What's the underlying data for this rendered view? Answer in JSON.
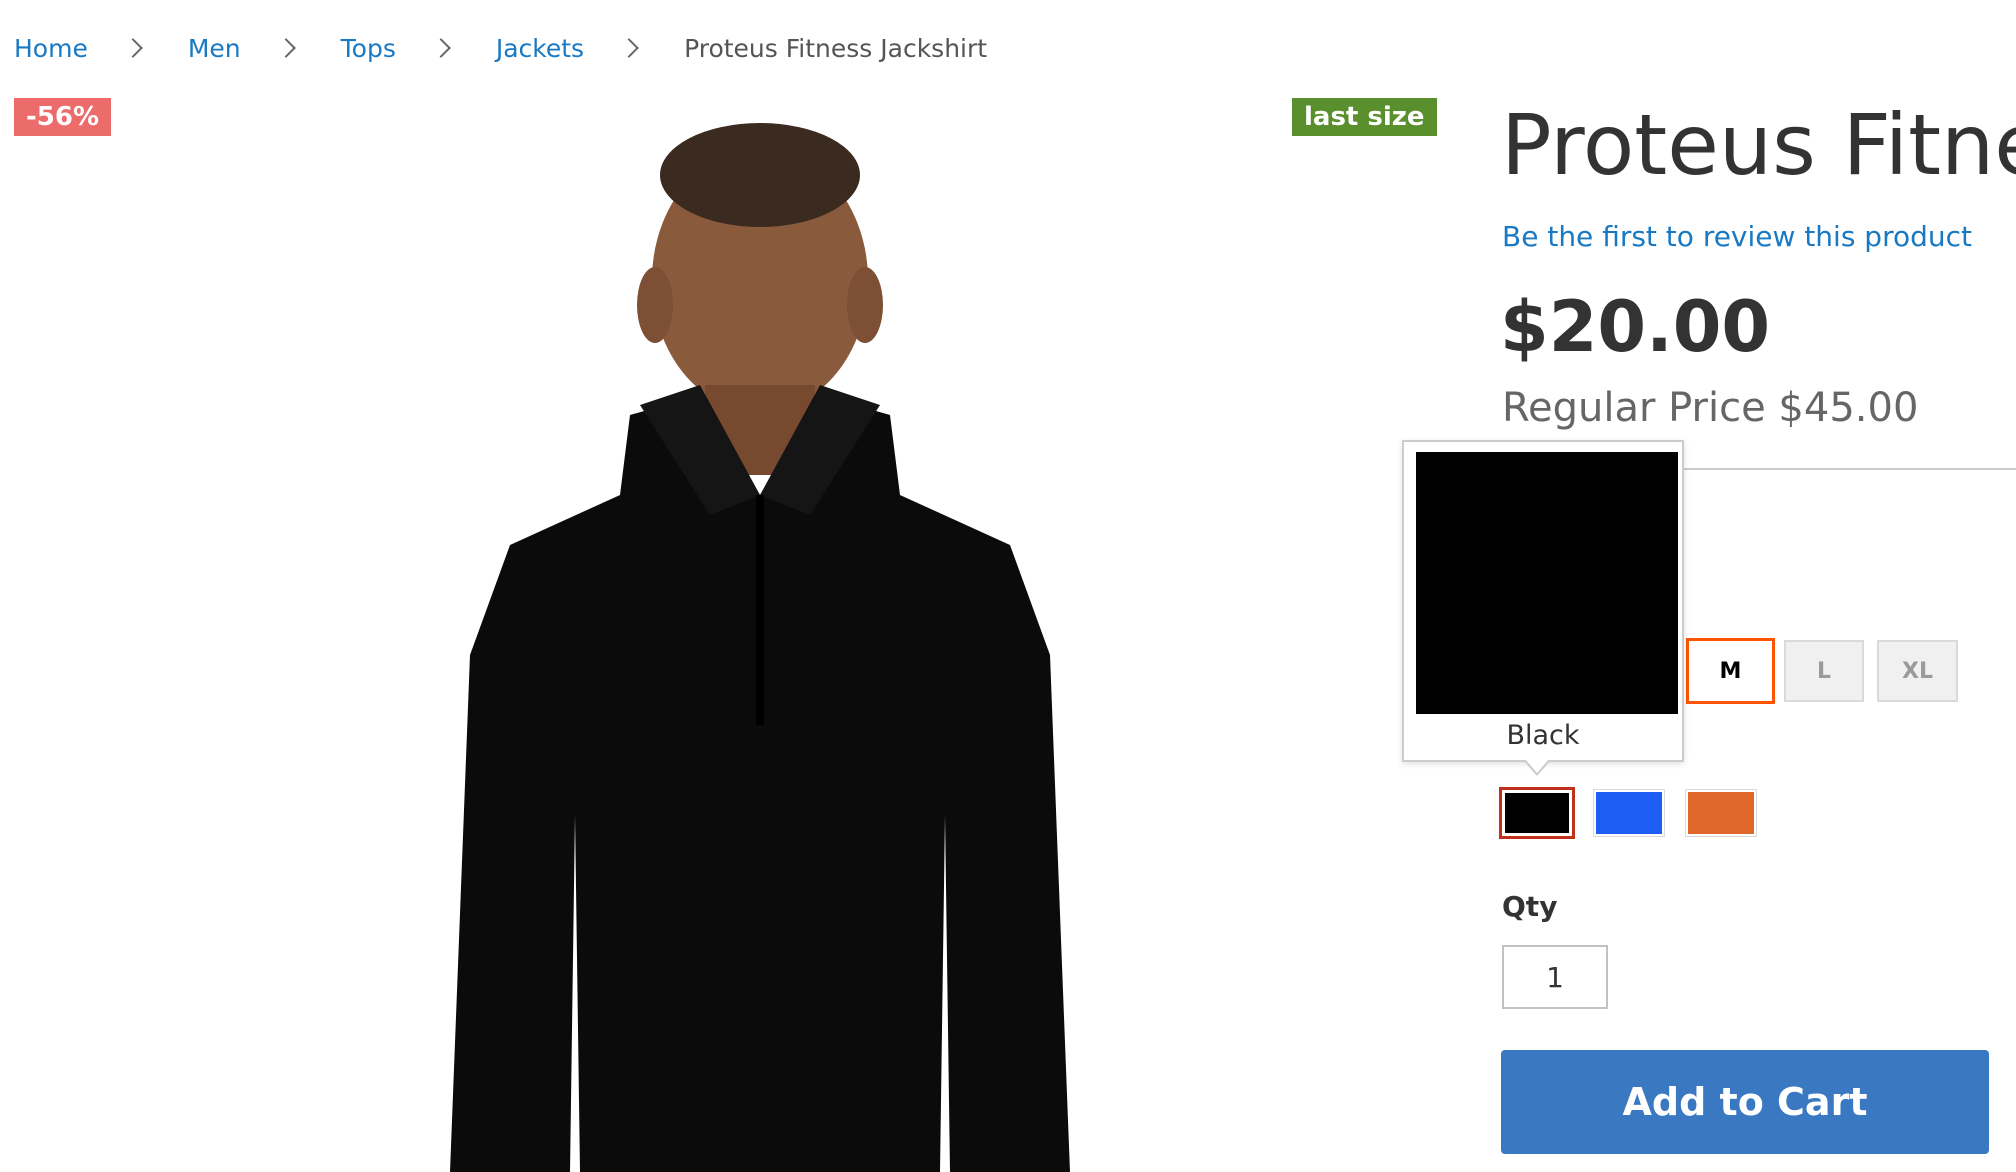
{
  "breadcrumbs": {
    "items": [
      {
        "label": "Home"
      },
      {
        "label": "Men"
      },
      {
        "label": "Tops"
      },
      {
        "label": "Jackets"
      }
    ],
    "current": "Proteus Fitness Jackshirt"
  },
  "badges": {
    "discount": "-56%",
    "last_size": "last size",
    "discount_color": "#ec6c6c",
    "last_size_color": "#5a8f2e"
  },
  "product": {
    "title": "Proteus Fitness Jackshirt",
    "title_visible": "Proteus Fitnes",
    "review_link": "Be the first to review this product",
    "price": "$20.00",
    "regular_price": "Regular Price $45.00"
  },
  "sizes": {
    "options": [
      {
        "label": "M",
        "selected": true
      },
      {
        "label": "L",
        "selected": false
      },
      {
        "label": "XL",
        "selected": false
      }
    ]
  },
  "colors": {
    "options": [
      {
        "name": "Black",
        "hex": "#000000",
        "selected": true
      },
      {
        "name": "Blue",
        "hex": "#1f5ef5",
        "selected": false
      },
      {
        "name": "Orange",
        "hex": "#e0682a",
        "selected": false
      }
    ],
    "tooltip_label": "Black",
    "tooltip_color": "#000000"
  },
  "qty": {
    "label": "Qty",
    "value": "1"
  },
  "actions": {
    "add_to_cart": "Add to Cart",
    "accent": "#3a78c2"
  }
}
